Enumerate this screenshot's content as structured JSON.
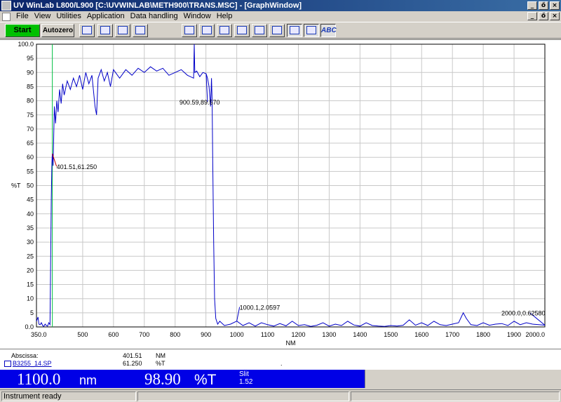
{
  "window": {
    "title": "UV WinLab L800/L900 [C:\\UVWINLAB\\METH900\\TRANS.MSC] - [GraphWindow]",
    "min": "_",
    "restore": "ő",
    "close": "×"
  },
  "menu": [
    "File",
    "View",
    "Utilities",
    "Application",
    "Data handling",
    "Window",
    "Help"
  ],
  "toolbar": {
    "start": "Start",
    "autozero": "Autozero",
    "abc": "ABC",
    "icons": [
      "scan-icon",
      "timedrive-icon",
      "wavelength-prog-icon",
      "samples-icon",
      "display-icon",
      "axis-icon",
      "overlay-icon",
      "zoom-icon",
      "expand-x-icon",
      "expand-y-icon",
      "cursor-icon",
      "peak-icon",
      "annotation-icon"
    ],
    "accent": "#1b3bb5",
    "start_color": "#00c000"
  },
  "chart_data": {
    "type": "line",
    "xlabel": "NM",
    "ylabel": "%T",
    "xlim": [
      350,
      2000
    ],
    "ylim": [
      0,
      100
    ],
    "x_ticks": [
      "350.0",
      "500",
      "600",
      "700",
      "800",
      "900",
      "1000",
      "1100",
      "1200",
      "1300",
      "1400",
      "1500",
      "1600",
      "1700",
      "1800",
      "1900",
      "2000.0"
    ],
    "y_ticks": [
      "0.0",
      "5",
      "10",
      "15",
      "20",
      "25",
      "30",
      "35",
      "40",
      "45",
      "50",
      "55",
      "60",
      "65",
      "70",
      "75",
      "80",
      "85",
      "90",
      "95",
      "100.0"
    ],
    "grid": true,
    "line_color": "#0000c8",
    "cursor_color": "#00c040",
    "cursor_x": 401.51,
    "series": [
      {
        "x": [
          350,
          355,
          358,
          362,
          366,
          370,
          374,
          378,
          382,
          386,
          390,
          394,
          398,
          400,
          401.5,
          404,
          408,
          412,
          416,
          420,
          425,
          430,
          435,
          440,
          450,
          460,
          470,
          480,
          490,
          500,
          510,
          520,
          530,
          540,
          545,
          550,
          560,
          570,
          580,
          590,
          600,
          620,
          640,
          660,
          680,
          700,
          720,
          740,
          760,
          780,
          800,
          820,
          840,
          860,
          862,
          864,
          870,
          880,
          890,
          900.59,
          905,
          910,
          915,
          918,
          920,
          922,
          925,
          928,
          932,
          938,
          945,
          960,
          980,
          1000.1,
          1020,
          1040,
          1060,
          1080,
          1100,
          1120,
          1140,
          1160,
          1180,
          1200,
          1220,
          1240,
          1260,
          1280,
          1300,
          1320,
          1340,
          1360,
          1380,
          1400,
          1420,
          1440,
          1460,
          1480,
          1500,
          1520,
          1540,
          1560,
          1580,
          1600,
          1620,
          1640,
          1660,
          1680,
          1700,
          1720,
          1735,
          1745,
          1760,
          1780,
          1800,
          1820,
          1840,
          1860,
          1880,
          1900,
          1920,
          1940,
          1960,
          1980,
          2000
        ],
        "y": [
          2.0,
          3.5,
          1.0,
          0.8,
          1.5,
          0.5,
          0.2,
          1.0,
          0.5,
          0.3,
          1.5,
          0.8,
          45.0,
          58.0,
          61.25,
          57.0,
          78.0,
          72.0,
          80.0,
          76.0,
          84.0,
          79.0,
          86.0,
          82.0,
          87.0,
          84.0,
          88.0,
          85.0,
          89.0,
          84.0,
          90.0,
          86.0,
          89.0,
          78.0,
          75.0,
          88.0,
          91.0,
          87.0,
          90.0,
          85.0,
          91.0,
          88.0,
          91.0,
          89.0,
          91.5,
          90.0,
          92.0,
          90.5,
          91.5,
          89.0,
          90.0,
          91.0,
          89.0,
          88.0,
          100.0,
          90.0,
          90.5,
          88.5,
          90.0,
          89.57,
          88.0,
          85.0,
          78.0,
          88.0,
          80.0,
          60.0,
          30.0,
          10.0,
          3.0,
          1.0,
          2.0,
          0.5,
          1.0,
          2.06,
          0.5,
          1.5,
          0.3,
          1.5,
          0.8,
          0.3,
          1.2,
          0.4,
          2.0,
          0.5,
          0.8,
          0.2,
          0.6,
          1.5,
          0.3,
          1.0,
          0.5,
          2.0,
          0.7,
          0.3,
          1.5,
          0.5,
          0.3,
          0.2,
          0.5,
          0.3,
          0.6,
          2.5,
          0.6,
          1.5,
          0.5,
          2.0,
          0.8,
          0.5,
          1.0,
          1.5,
          5.0,
          3.0,
          0.8,
          0.5,
          1.5,
          0.6,
          1.0,
          1.2,
          0.5,
          2.0,
          0.8,
          1.5,
          1.0,
          0.8,
          0.63
        ]
      }
    ],
    "annotations": [
      {
        "x": 401.51,
        "y": 61.25,
        "text": "401.51,61.250"
      },
      {
        "x": 900.59,
        "y": 89.57,
        "text": "900.59,89.570"
      },
      {
        "x": 1000.1,
        "y": 2.0597,
        "text": "1000.1,2.0597"
      },
      {
        "x": 2000.0,
        "y": 0.6258,
        "text": "2000.0,0.62580"
      }
    ]
  },
  "info": {
    "abscissa_label": "Abscissa:",
    "abscissa_value": "401.51",
    "abscissa_unit": "NM",
    "file_link": "B3255_14.SP",
    "ordinate_value": "61.250",
    "ordinate_unit": "%T",
    "dot": "."
  },
  "readout": {
    "wavelength": "1100.0",
    "wavelength_unit": "nm",
    "value": "98.90",
    "value_unit": "%T",
    "slit_label": "Slit",
    "slit_value": "1.52",
    "bg": "#0000e6"
  },
  "status": {
    "text": "Instrument ready"
  }
}
